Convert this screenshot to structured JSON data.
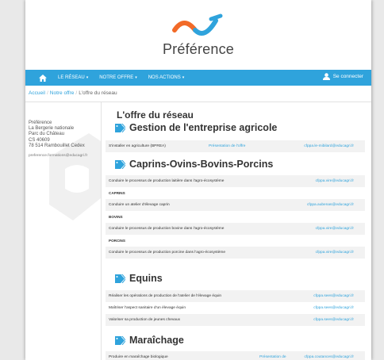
{
  "brand": {
    "name": "Préférence",
    "colors": {
      "orange": "#f26a28",
      "blue": "#2fa3dc"
    }
  },
  "nav": {
    "home_icon": "home-icon",
    "items": [
      "LE RÉSEAU",
      "NOTRE OFFRE",
      "NOS ACTIONS"
    ],
    "caret": "▾",
    "login": "Se connecter"
  },
  "breadcrumb": {
    "items": [
      "Accueil",
      "Notre offre",
      "L'offre du réseau"
    ],
    "sep": "/"
  },
  "sidebar": {
    "address": [
      "Préférence",
      "La Bergerie nationale",
      "Parc du Château",
      "CS 40609",
      "78 514 Rambouillet Cedex"
    ],
    "email": "preference.formations@educagri.fr"
  },
  "main": {
    "title": "L'offre du réseau",
    "sections": [
      {
        "title": "Gestion de l'entreprise agricole",
        "rows": [
          {
            "label": "S'installer en agriculture (BPREA)",
            "link": "Présentation de l'offre",
            "email": "cfppa.le-mibilard@educagri.fr",
            "cat": false
          }
        ]
      },
      {
        "title": "Caprins-Ovins-Bovins-Porcins",
        "rows": [
          {
            "label": "Conduire le processus de production laitière dans l'agro-écosystème",
            "link": "",
            "email": "cfppa.vire@educagri.fr",
            "cat": false
          },
          {
            "label": "CAPRINS",
            "link": "",
            "email": "",
            "cat": true
          },
          {
            "label": "Conduire un atelier d'élevage caprin",
            "link": "",
            "email": "cfppa.aubenas@educagri.fr",
            "cat": false
          },
          {
            "label": "BOVINS",
            "link": "",
            "email": "",
            "cat": true
          },
          {
            "label": "Conduire le processus de production bovine dans l'agro-écosystème",
            "link": "",
            "email": "cfppa.vire@educagri.fr",
            "cat": false
          },
          {
            "label": "PORCINS",
            "link": "",
            "email": "",
            "cat": true
          },
          {
            "label": "Conduire le processus de production porcine dans l'agro-écosystème",
            "link": "",
            "email": "cfppa.vire@educagri.fr",
            "cat": false
          }
        ]
      },
      {
        "title": "Equins",
        "rows": [
          {
            "label": "Réaliser les opérations de production de l'atelier de l'élevage équin",
            "link": "",
            "email": "cfppa.sees@educagri.fr",
            "cat": false
          },
          {
            "label": "Maîtriser l'aspect sanitaire d'un élevage équin",
            "link": "",
            "email": "cfppa.sees@educagri.fr",
            "cat": false
          },
          {
            "label": "Valoriser sa production de jeunes chevaux",
            "link": "",
            "email": "cfppa.sees@educagri.fr",
            "cat": false
          }
        ]
      },
      {
        "title": "Maraîchage",
        "rows": [
          {
            "label": "Produire en maraîchage biologique",
            "link": "Présentation de",
            "email": "cfppa.coutances@educagri.fr",
            "cat": false
          }
        ]
      }
    ]
  }
}
